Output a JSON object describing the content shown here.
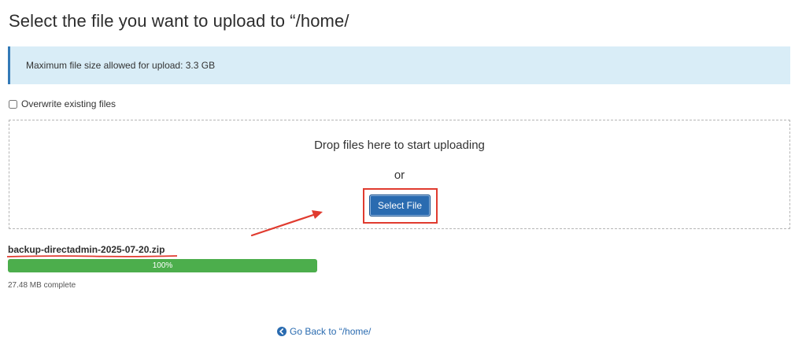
{
  "page": {
    "title": "Select the file you want to upload to “/home/"
  },
  "alert": {
    "text": "Maximum file size allowed for upload: 3.3 GB"
  },
  "overwrite": {
    "label": "Overwrite existing files",
    "checked": false
  },
  "dropzone": {
    "text": "Drop files here to start uploading",
    "or_text": "or",
    "select_button_label": "Select File"
  },
  "upload": {
    "file_name": "backup-directadmin-2025-07-20.zip",
    "progress_percent": 100,
    "progress_label": "100%",
    "complete_text": "27.48 MB complete"
  },
  "footer": {
    "go_back_label": "Go Back to “/home/",
    "go_back_icon": "circle-arrow-left-icon"
  },
  "colors": {
    "accent": "#2a6bb0",
    "alert_bg": "#d9edf7",
    "progress": "#4cae4c",
    "annotation": "#e03b2f"
  }
}
